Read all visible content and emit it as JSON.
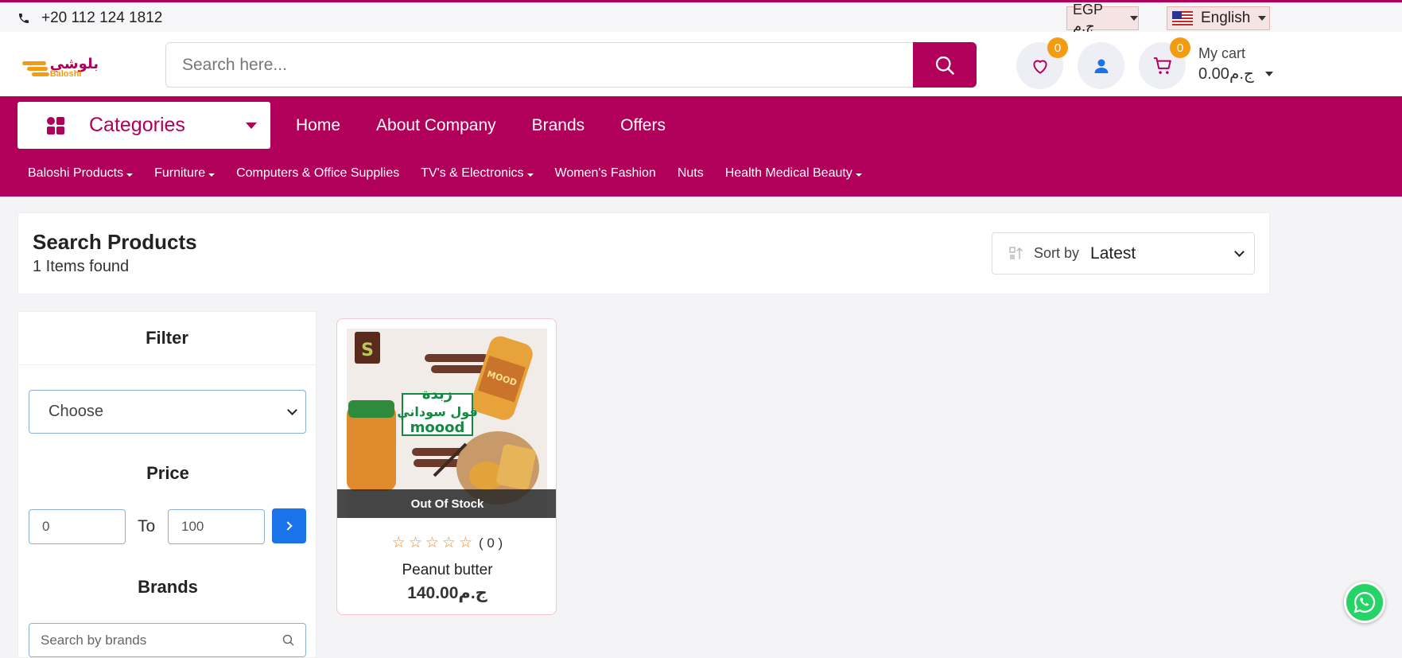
{
  "topbar": {
    "phone": "+20 112 124 1812",
    "currency": "EGP ج.م",
    "language": "English"
  },
  "header": {
    "logo_arabic": "بلوشي",
    "logo_latin": "Baloshi",
    "search_placeholder": "Search here...",
    "wishlist_count": "0",
    "cart_count": "0",
    "cart_label": "My cart",
    "cart_total": "0.00ج.م"
  },
  "nav": {
    "categories_label": "Categories",
    "main": [
      "Home",
      "About Company",
      "Brands",
      "Offers"
    ],
    "sub": [
      {
        "label": "Baloshi Products",
        "dropdown": true
      },
      {
        "label": "Furniture",
        "dropdown": true
      },
      {
        "label": "Computers & Office Supplies",
        "dropdown": false
      },
      {
        "label": "TV's & Electronics",
        "dropdown": true
      },
      {
        "label": "Women's Fashion",
        "dropdown": false
      },
      {
        "label": "Nuts",
        "dropdown": false
      },
      {
        "label": "Health Medical Beauty",
        "dropdown": true
      }
    ]
  },
  "results": {
    "title": "Search Products",
    "count": "1 Items found",
    "sort_label": "Sort by",
    "sort_value": "Latest"
  },
  "filter": {
    "title": "Filter",
    "choose_placeholder": "Choose",
    "price_title": "Price",
    "price_min": "0",
    "price_max": "100",
    "to_label": "To",
    "brands_title": "Brands",
    "brand_search_placeholder": "Search by brands"
  },
  "product": {
    "stock_label": "Out Of Stock",
    "rating_count": "( 0 )",
    "name": "Peanut butter",
    "price": "140.00ج.م",
    "image_text": {
      "headline_1": "زبدة",
      "headline_2": "فول سوداني",
      "headline_3": "moood",
      "jar_label": "MOOD"
    }
  },
  "colors": {
    "brand": "#b0005a",
    "accent": "#f39c12",
    "button_blue": "#1a73e8",
    "star": "#f28c28"
  }
}
